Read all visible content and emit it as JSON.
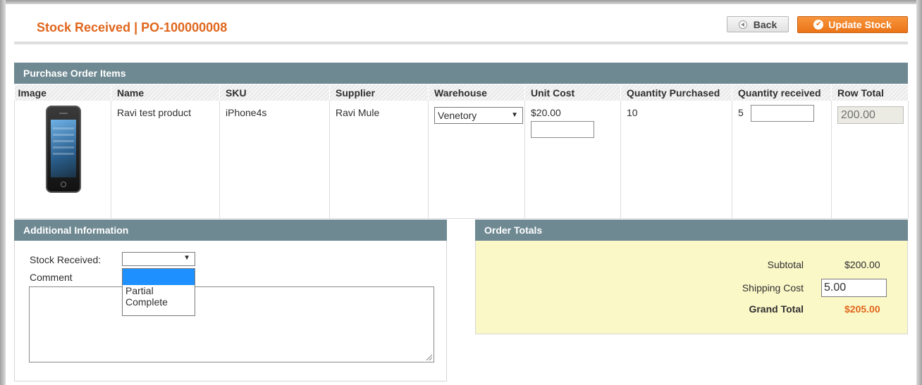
{
  "header": {
    "title": "Stock Received | PO-100000008",
    "back_label": "Back",
    "update_label": "Update Stock"
  },
  "po_items": {
    "section_title": "Purchase Order Items",
    "columns": [
      "Image",
      "Name",
      "SKU",
      "Supplier",
      "Warehouse",
      "Unit Cost",
      "Quantity Purchased",
      "Quantity received",
      "Row Total"
    ],
    "row": {
      "image_icon": "iphone-product-image",
      "name": "Ravi test product",
      "sku": "iPhone4s",
      "supplier": "Ravi Mule",
      "warehouse": "Venetory",
      "unit_cost": "$20.00",
      "unit_cost_input": "",
      "quantity_purchased": "10",
      "quantity_received_prefix": "5",
      "quantity_received_input": "",
      "row_total": "200.00"
    }
  },
  "additional_info": {
    "section_title": "Additional Information",
    "stock_received_label": "Stock Received:",
    "stock_received_value": "",
    "dropdown_options": [
      "",
      "Partial",
      "Complete"
    ],
    "comment_label": "Comment",
    "comment_value": ""
  },
  "order_totals": {
    "section_title": "Order Totals",
    "subtotal_label": "Subtotal",
    "subtotal_value": "$200.00",
    "shipping_label": "Shipping Cost",
    "shipping_value": "5.00",
    "grand_total_label": "Grand Total",
    "grand_total_value": "$205.00"
  },
  "colors": {
    "accent": "#e0661c",
    "section_header": "#6f8992",
    "totals_bg": "#fbf8c8"
  }
}
